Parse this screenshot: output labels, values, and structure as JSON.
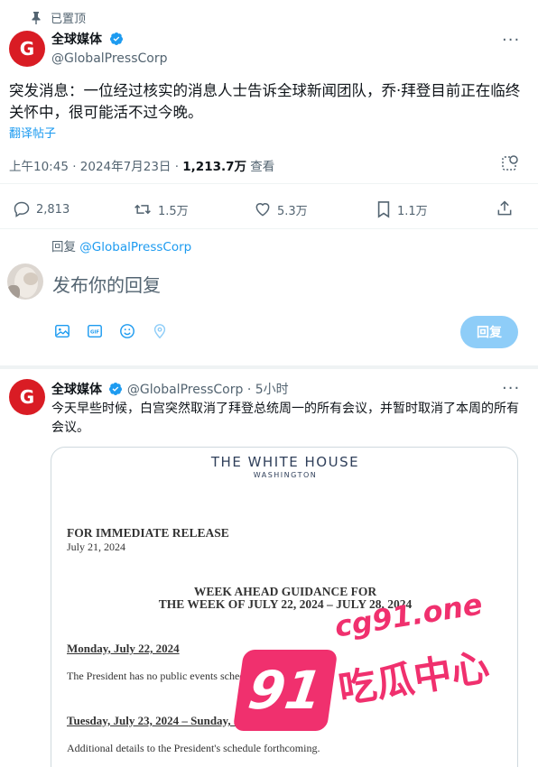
{
  "pinned": {
    "label": "已置顶"
  },
  "tweet": {
    "author_name": "全球媒体",
    "handle": "@GlobalPressCorp",
    "avatar_letter": "G",
    "body": "突发消息：一位经过核实的消息人士告诉全球新闻团队，乔·拜登目前正在临终关怀中，很可能活不过今晚。",
    "translate_label": "翻译帖子",
    "timestamp": "上午10:45 · 2024年7月23日 · ",
    "views_count": "1,213.7万",
    "views_label": " 查看",
    "replies": "2,813",
    "reposts": "1.5万",
    "likes": "5.3万",
    "bookmarks": "1.1万"
  },
  "reply_box": {
    "reply_to_prefix": "回复 ",
    "reply_to_handle": "@GlobalPressCorp",
    "placeholder": "发布你的回复",
    "submit_label": "回复"
  },
  "second_tweet": {
    "author_name": "全球媒体",
    "handle": "@GlobalPressCorp",
    "time": " · 5小时",
    "avatar_letter": "G",
    "body": "今天早些时候，白宫突然取消了拜登总统周一的所有会议，并暂时取消了本周的所有会议。"
  },
  "document": {
    "header_title": "THE WHITE HOUSE",
    "header_sub": "WASHINGTON",
    "release": "FOR IMMEDIATE RELEASE",
    "date": "July 21, 2024",
    "guidance_line1": "WEEK AHEAD GUIDANCE FOR",
    "guidance_line2": "THE WEEK OF JULY 22, 2024 – JULY 28, 2024",
    "section1_title": "Monday, July 22, 2024",
    "section1_text": "The President has no public events scheduled.",
    "section2_title": "Tuesday, July 23, 2024 – Sunday, July 28, 2024",
    "section2_text": "Additional details to the President's schedule forthcoming."
  },
  "watermark": {
    "number": "91",
    "domain": "cg91.one",
    "tagline": "吃瓜中心",
    "color": "#f0306e"
  },
  "colors": {
    "accent": "#1d9bf0",
    "brand_red": "#d91c24"
  }
}
